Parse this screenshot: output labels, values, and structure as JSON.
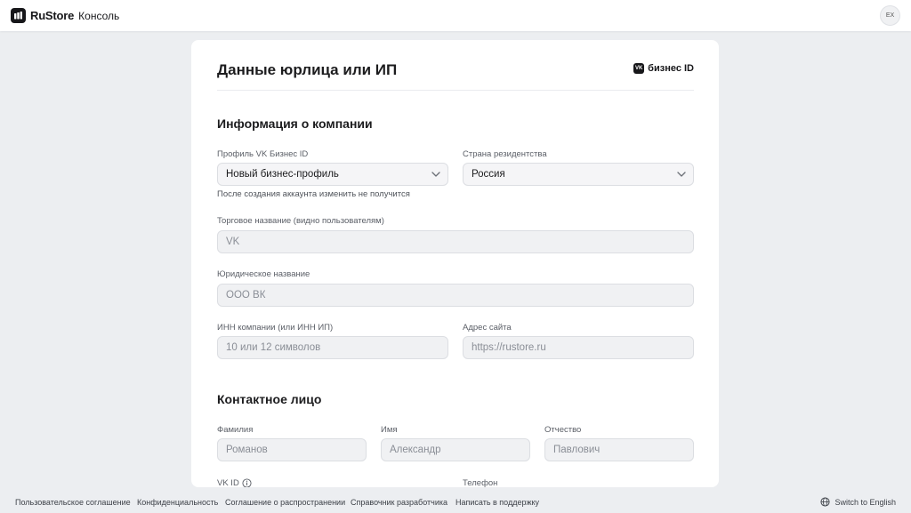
{
  "header": {
    "brand": "RuStore",
    "section": "Консоль",
    "avatar_initials": "EX"
  },
  "card": {
    "title": "Данные юрлица или ИП",
    "partner_logo_text": "бизнес ID",
    "partner_logo_mark": "VK"
  },
  "company_section": {
    "title": "Информация о компании",
    "profile": {
      "label": "Профиль VK Бизнес ID",
      "value": "Новый бизнес-профиль",
      "hint": "После создания аккаунта изменить не получится"
    },
    "country": {
      "label": "Страна резидентства",
      "value": "Россия"
    },
    "trade_name": {
      "label": "Торговое название (видно пользователям)",
      "placeholder": "VK"
    },
    "legal_name": {
      "label": "Юридическое название",
      "placeholder": "ООО ВК"
    },
    "inn": {
      "label": "ИНН компании (или ИНН ИП)",
      "placeholder": "10 или 12 символов"
    },
    "website": {
      "label": "Адрес сайта",
      "placeholder": "https://rustore.ru"
    }
  },
  "contact_section": {
    "title": "Контактное лицо",
    "last_name": {
      "label": "Фамилия",
      "placeholder": "Романов"
    },
    "first_name": {
      "label": "Имя",
      "placeholder": "Александр"
    },
    "middle_name": {
      "label": "Отчество",
      "placeholder": "Павлович"
    },
    "vk_id": {
      "label": "VK ID"
    },
    "phone": {
      "label": "Телефон"
    }
  },
  "footer": {
    "links": [
      "Пользовательское соглашение",
      "Конфиденциальность",
      "Соглашение о распространении",
      "Справочник разработчика",
      "Написать в поддержку"
    ],
    "language": "Switch to English"
  },
  "icons": {
    "brand_logo": "rustore-logo-icon",
    "chevron": "chevron-down-icon",
    "info": "info-icon",
    "globe": "globe-icon"
  },
  "colors": {
    "page_background": "#eceef1",
    "card_background": "#ffffff",
    "input_background": "#f0f1f3",
    "brand_dark": "#17171a"
  }
}
